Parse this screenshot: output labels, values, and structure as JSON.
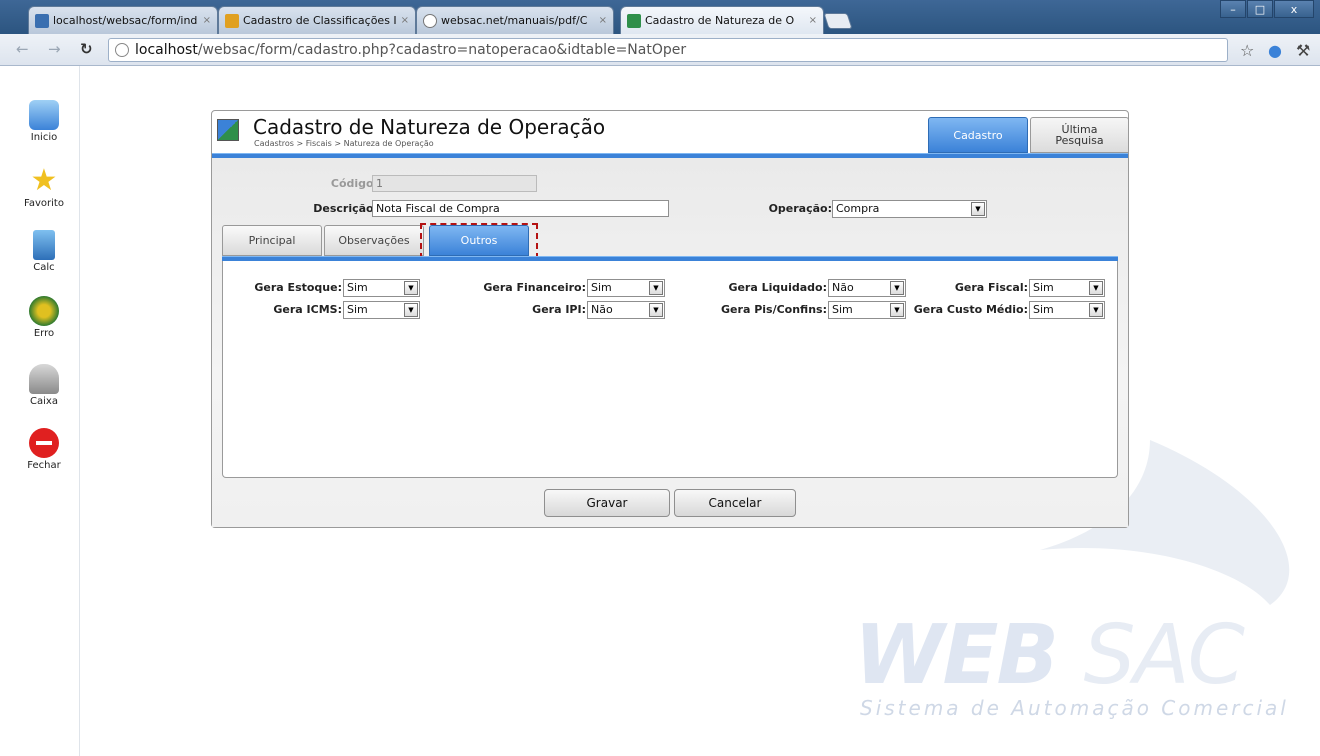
{
  "browser": {
    "tabs": [
      {
        "label": "localhost/websac/form/ind",
        "active": false
      },
      {
        "label": "Cadastro de Classificações I",
        "active": false
      },
      {
        "label": "websac.net/manuais/pdf/C",
        "active": false
      },
      {
        "label": "Cadastro de Natureza de O",
        "active": true
      }
    ],
    "tab_close": "×",
    "url_host": "localhost",
    "url_path": "/websac/form/cadastro.php?cadastro=natoperacao&idtable=NatOper",
    "window_buttons": {
      "minimize": "–",
      "maximize": "□",
      "close": "x"
    }
  },
  "sidebar": {
    "items": [
      {
        "label": "Inicio",
        "icon": "home-icon"
      },
      {
        "label": "Favorito",
        "icon": "star-icon"
      },
      {
        "label": "Calc",
        "icon": "calculator-icon"
      },
      {
        "label": "Erro",
        "icon": "bug-icon"
      },
      {
        "label": "Caixa",
        "icon": "mailbox-icon"
      },
      {
        "label": "Fechar",
        "icon": "close-icon"
      }
    ]
  },
  "page": {
    "title": "Cadastro de Natureza de Operação",
    "breadcrumb": "Cadastros > Fiscais > Natureza de Operação",
    "right_tabs": {
      "active": "Cadastro",
      "inactive_line1": "Última",
      "inactive_line2": "Pesquisa"
    }
  },
  "form": {
    "codigo_label": "Código:",
    "codigo_value": "1",
    "descricao_label": "Descrição:",
    "descricao_value": "Nota Fiscal de Compra",
    "operacao_label": "Operação:",
    "operacao_value": "Compra",
    "tabs": [
      {
        "label": "Principal",
        "active": false
      },
      {
        "label": "Observações",
        "active": false
      },
      {
        "label": "Outros",
        "active": true
      }
    ],
    "outros": {
      "gera_estoque": {
        "label": "Gera Estoque:",
        "value": "Sim"
      },
      "gera_financeiro": {
        "label": "Gera Financeiro:",
        "value": "Sim"
      },
      "gera_liquidado": {
        "label": "Gera Liquidado:",
        "value": "Não"
      },
      "gera_fiscal": {
        "label": "Gera Fiscal:",
        "value": "Sim"
      },
      "gera_icms": {
        "label": "Gera ICMS:",
        "value": "Sim"
      },
      "gera_ipi": {
        "label": "Gera IPI:",
        "value": "Não"
      },
      "gera_pis_confins": {
        "label": "Gera Pis/Confins:",
        "value": "Sim"
      },
      "gera_custo_medio": {
        "label": "Gera Custo Médio:",
        "value": "Sim"
      }
    },
    "buttons": {
      "save": "Gravar",
      "cancel": "Cancelar"
    }
  },
  "watermark": {
    "brand_bold": "WEB",
    "brand_thin": "SAC",
    "tagline": "Sistema de Automação Comercial"
  },
  "colors": {
    "accent": "#3b82d8",
    "highlight_border": "#b41212",
    "titlebar": "#3e6796"
  }
}
